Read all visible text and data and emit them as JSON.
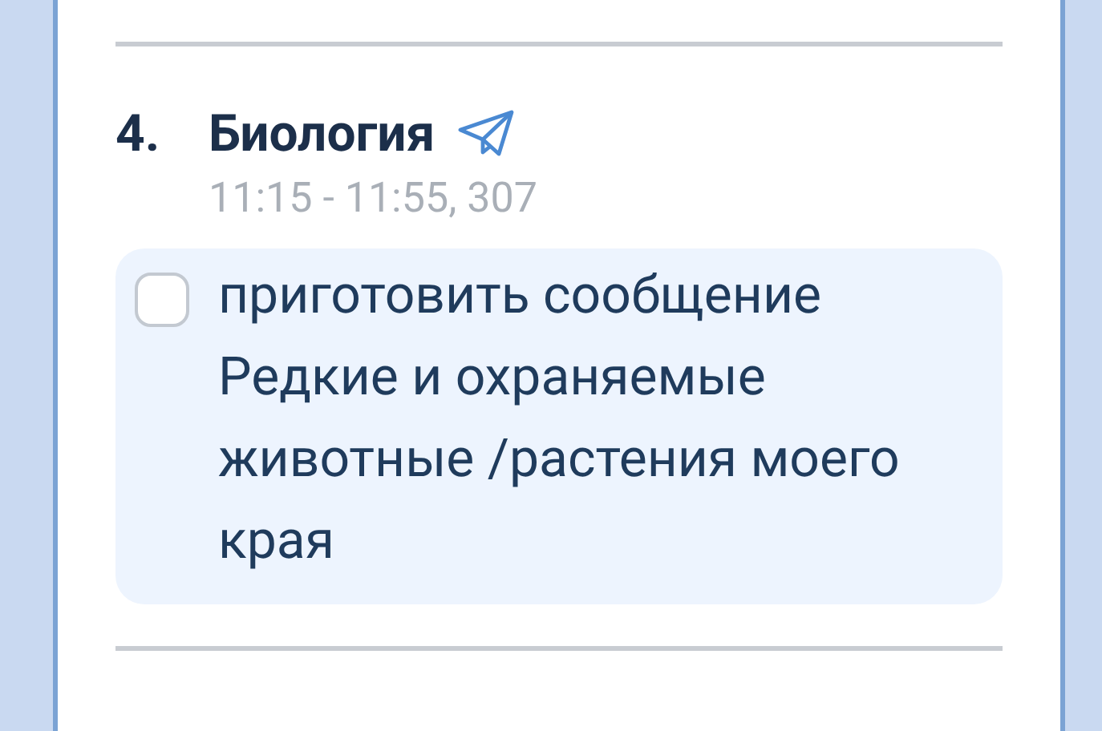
{
  "lesson": {
    "number": "4.",
    "subject": "Биология",
    "time": "11:15 - 11:55, 307"
  },
  "tasks": [
    {
      "text": "приготовить сообщение Редкие и охраняемые животные /растения моего края",
      "checked": false
    }
  ]
}
